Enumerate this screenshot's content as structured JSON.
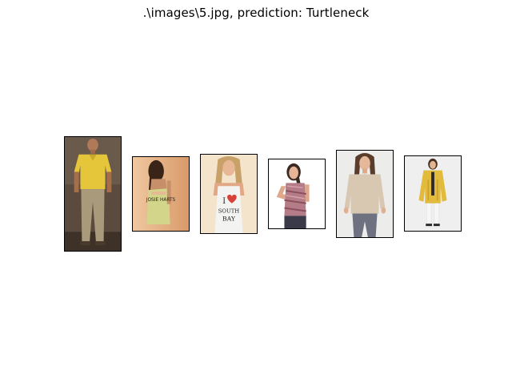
{
  "title": ".\\images\\5.jpg, prediction: Turtleneck",
  "images": [
    {
      "label": "query image: man in yellow polo shirt and khaki pants",
      "colors": {
        "top": "#e7c63a",
        "bottom": "#a89a7c",
        "bg": "#5a4a3e"
      }
    },
    {
      "label": "result 1: woman in light green dress",
      "colors": {
        "top": "#d2d48a",
        "bg": "#e8b48a"
      },
      "printed_text": "JOSIE HARTS"
    },
    {
      "label": "result 2: woman in white graphic tank top",
      "colors": {
        "top": "#f2f2f0",
        "accent": "#d8403a",
        "bg": "#f5e6cf"
      },
      "printed_text": "I ♥ SOUTH BAY"
    },
    {
      "label": "result 3: woman in pink patterned tank top",
      "colors": {
        "top": "#b07882",
        "bg": "#ffffff"
      }
    },
    {
      "label": "result 4: woman in beige knit sweater",
      "colors": {
        "top": "#d7c6b0",
        "bottom": "#6e7280",
        "bg": "#ececec"
      }
    },
    {
      "label": "result 5: woman in yellow trench coat",
      "colors": {
        "top": "#e2b93a",
        "bottom": "#f4f4f4",
        "bg": "#f0f0f0"
      }
    }
  ]
}
